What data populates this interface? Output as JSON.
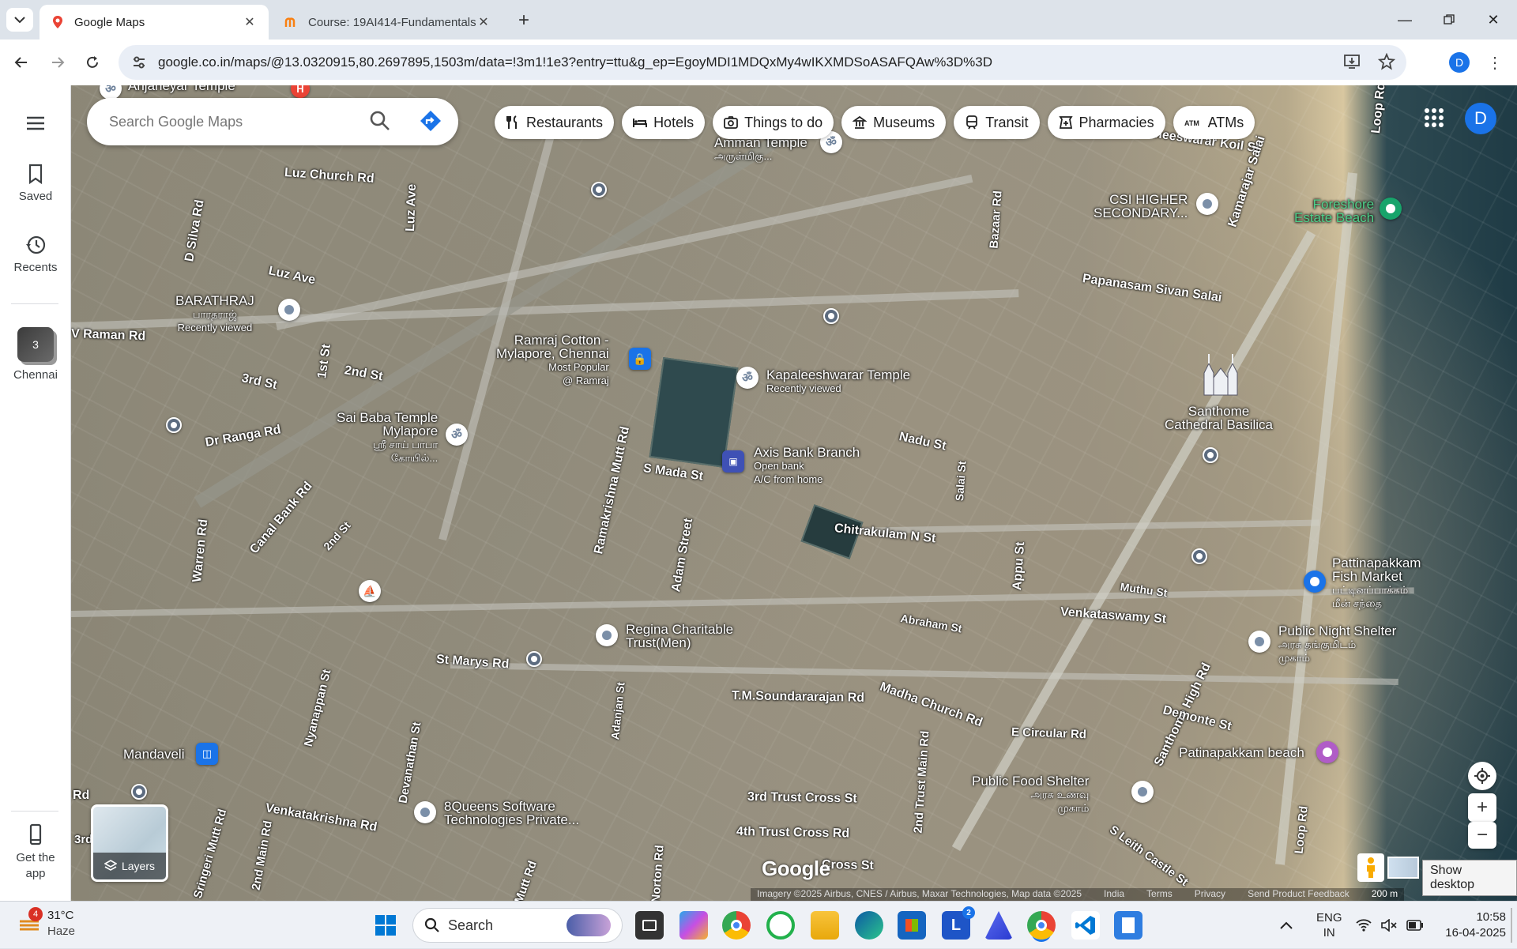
{
  "browser": {
    "tabs": [
      {
        "title": "Google Maps",
        "active": true
      },
      {
        "title": "Course: 19AI414-Fundamentals",
        "active": false
      }
    ],
    "url": "google.co.in/maps/@13.0320915,80.2697895,1503m/data=!3m1!1e3?entry=ttu&g_ep=EgoyMDI1MDQxMy4wIKXMDSoASAFQAw%3D%3D",
    "profile_initial": "D"
  },
  "rail": {
    "saved": "Saved",
    "recents": "Recents",
    "chennai": "Chennai",
    "chennai_count": "3",
    "get_app": "Get the app"
  },
  "search": {
    "placeholder": "Search Google Maps"
  },
  "chips": [
    "Restaurants",
    "Hotels",
    "Things to do",
    "Museums",
    "Transit",
    "Pharmacies",
    "ATMs"
  ],
  "map_avatar": "D",
  "streets": {
    "luz_church_rd": "Luz Church Rd",
    "luz_ave_v": "Luz Ave",
    "luz_ave": "Luz Ave",
    "d_silva_rd": "D Silva Rd",
    "v_raman_rd": "V Raman Rd",
    "first_st": "1st St",
    "second_st": "2nd St",
    "third_st": "3rd St",
    "dr_ranga_rd": "Dr Ranga Rd",
    "canal_bank_rd": "Canal Bank Rd",
    "second_st_b": "2nd St",
    "warren_rd": "Warren Rd",
    "s_mada_st": "S Mada St",
    "ramakrishna_mutt_rd": "Ramakrishna Mutt Rd",
    "adam_street": "Adam Street",
    "chitrakulam_n_st": "Chitrakulam N St",
    "nadu_st": "Nadu St",
    "salai_st": "Salai St",
    "appu_st": "Appu St",
    "bazaar_rd": "Bazaar Rd",
    "karaneeswarar_koil_st": "Karaneeswarar Koil St",
    "papanasam_sivan_salai": "Papanasam Sivan Salai",
    "kamarajar_salai": "Kamarajar Salai",
    "loop_rd_top": "Loop Rd",
    "muthu_st": "Muthu St",
    "venkataswamy_st": "Venkataswamy St",
    "abraham_st": "Abraham St",
    "santhome_high_rd": "Santhome High Rd",
    "demonte_st": "Demonte St",
    "e_circular_rd": "E Circular Rd",
    "madha_church_rd": "Madha Church Rd",
    "tm_soundararajan_rd": "T.M.Soundararajan Rd",
    "st_marys_rd": "St Marys Rd",
    "adanjan_st": "Adanjan St",
    "nyanappan_st": "Nyanappan St",
    "devanathan_st": "Devanathan St",
    "venkatakrishna_rd": "Venkatakrishna Rd",
    "second_main_rd": "2nd Main Rd",
    "srinigeri_mutt_rd": "Sringeri Mutt Rd",
    "norton_rd": "Norton Rd",
    "mutt_rd": "Mutt Rd",
    "third_trust_cross_st": "3rd Trust Cross St",
    "fourth_trust_cross_rd": "4th Trust Cross Rd",
    "cross_st": "Cross St",
    "second_trust_main_rd": "2nd Trust Main Rd",
    "s_leith_castle_st": "S Leith Castle St",
    "loop_rd": "Loop Rd",
    "rd_left": "Rd",
    "third_left": "3rd"
  },
  "places": {
    "anjaneyar": "Anjaneyar Temple",
    "amman_temple": "Amman Temple",
    "amman_temple_ta": "அருள்மிகு...",
    "barathraj": "BARATHRAJ",
    "barathraj_ta": "பாரதராஜ்",
    "barathraj_sub": "Recently viewed",
    "ramraj_1": "Ramraj Cotton -",
    "ramraj_2": "Mylapore, Chennai",
    "ramraj_sub1": "Most Popular",
    "ramraj_sub2": "@ Ramraj",
    "kapaleeshwarar": "Kapaleeshwarar Temple",
    "kapaleeshwarar_sub": "Recently viewed",
    "saibaba_1": "Sai Baba Temple",
    "saibaba_2": "Mylapore",
    "saibaba_ta1": "ஸ்ரீ சாய் பாபா",
    "saibaba_ta2": "கோயில்...",
    "axis_bank": "Axis Bank Branch",
    "axis_sub1": "Open bank",
    "axis_sub2": "A/C from home",
    "csi_1": "CSI HIGHER",
    "csi_2": "SECONDARY...",
    "foreshore_1": "Foreshore",
    "foreshore_2": "Estate Beach",
    "santhome_1": "Santhome",
    "santhome_2": "Cathedral Basilica",
    "pattinapakkam_1": "Pattinapakkam",
    "pattinapakkam_2": "Fish Market",
    "pattinapakkam_ta1": "பட்டினப்பாக்கம்",
    "pattinapakkam_ta2": "மீன் சந்தை",
    "public_night_1": "Public Night Shelter",
    "public_night_ta1": "அரசு தங்குமிடம்",
    "public_night_ta2": "முகாம்",
    "regina_1": "Regina Charitable",
    "regina_2": "Trust(Men)",
    "patinapakkam_beach": "Patinapakkam beach",
    "mandaveli": "Mandaveli",
    "public_food_1": "Public Food Shelter",
    "public_food_ta1": "அரசு உணவு",
    "public_food_ta2": "முகாம்",
    "queens_1": "8Queens Software",
    "queens_2": "Technologies Private..."
  },
  "map_controls": {
    "layers": "Layers",
    "tooltip": "Show desktop",
    "google": "Google"
  },
  "attribution": {
    "imagery": "Imagery ©2025 Airbus, CNES / Airbus, Maxar Technologies, Map data ©2025",
    "india": "India",
    "terms": "Terms",
    "privacy": "Privacy",
    "feedback": "Send Product Feedback",
    "scale": "200 m"
  },
  "taskbar": {
    "weather_badge": "4",
    "temperature": "31°C",
    "condition": "Haze",
    "search": "Search",
    "lang_1": "ENG",
    "lang_2": "IN",
    "time": "10:58",
    "date": "16-04-2025",
    "l_badge": "2"
  }
}
